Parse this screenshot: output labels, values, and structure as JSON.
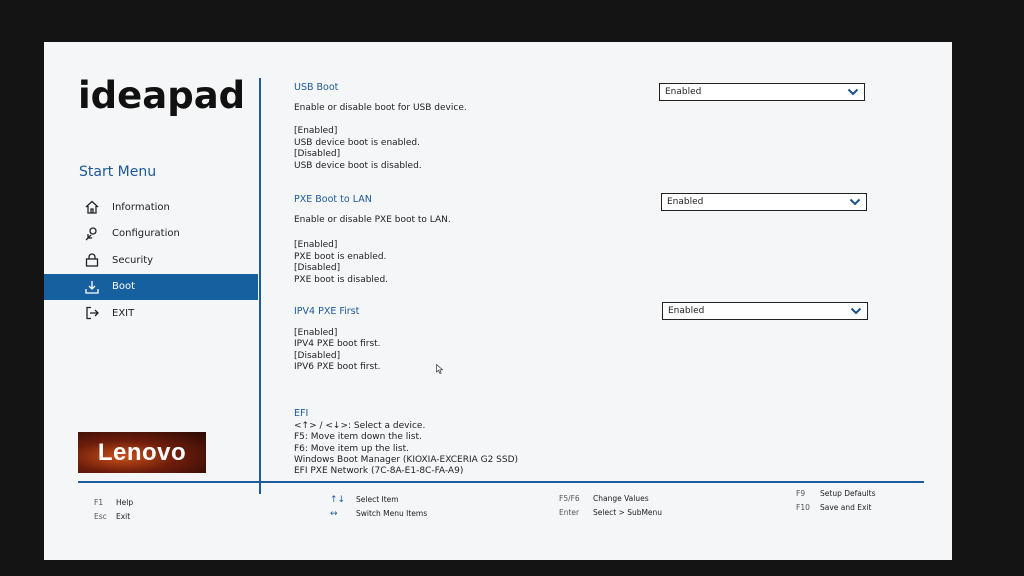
{
  "brand": {
    "logo_text": "ideapad",
    "lenovo_text": "Lenovo"
  },
  "menu": {
    "title": "Start Menu",
    "items": [
      {
        "label": "Information",
        "icon": "home-icon"
      },
      {
        "label": "Configuration",
        "icon": "configuration-icon"
      },
      {
        "label": "Security",
        "icon": "lock-icon"
      },
      {
        "label": "Boot",
        "icon": "boot-icon",
        "active": true
      },
      {
        "label": "EXIT",
        "icon": "exit-icon"
      }
    ]
  },
  "settings": {
    "usb_boot": {
      "title": "USB Boot",
      "description": "Enable or disable boot for USB device.",
      "help": [
        "[Enabled]",
        "USB device boot is enabled.",
        "[Disabled]",
        "USB device boot is disabled."
      ],
      "value": "Enabled"
    },
    "pxe_boot": {
      "title": "PXE Boot to LAN",
      "description": "Enable or disable PXE boot to LAN.",
      "help": [
        "[Enabled]",
        "PXE boot is enabled.",
        "[Disabled]",
        "PXE boot is disabled."
      ],
      "value": "Enabled"
    },
    "ipv4_pxe": {
      "title": "IPV4 PXE First",
      "help": [
        "[Enabled]",
        "IPV4 PXE boot first.",
        "[Disabled]",
        "IPV6 PXE boot first."
      ],
      "value": "Enabled"
    }
  },
  "efi": {
    "title": "EFI",
    "lines": [
      "<↑> / <↓>: Select a device.",
      "F5: Move item down the list.",
      "F6: Move item up the list.",
      "Windows Boot Manager (KIOXIA-EXCERIA G2 SSD)",
      "EFI PXE Network (7C-8A-E1-8C-FA-A9)"
    ]
  },
  "footer": {
    "f1_key": "F1",
    "f1_label": "Help",
    "esc_key": "Esc",
    "esc_label": "Exit",
    "select_item_key": "↑↓",
    "select_item_label": "Select Item",
    "switch_key": "↔",
    "switch_label": "Switch Menu Items",
    "f5f6_key": "F5/F6",
    "f5f6_label": "Change Values",
    "enter_key": "Enter",
    "enter_label": "Select > SubMenu",
    "f9_key": "F9",
    "f9_label": "Setup Defaults",
    "f10_key": "F10",
    "f10_label": "Save and Exit"
  },
  "colors": {
    "accent": "#17609f",
    "background": "#f4f6f7",
    "text": "#222222"
  }
}
